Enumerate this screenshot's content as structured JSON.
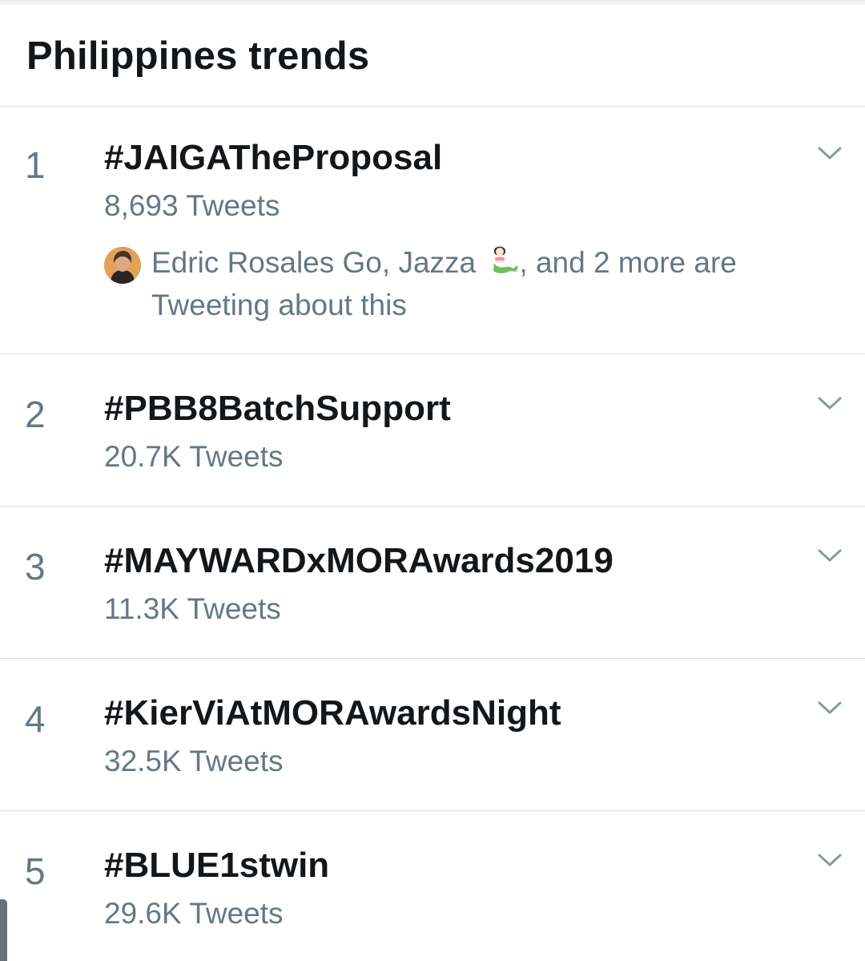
{
  "header": {
    "title": "Philippines trends"
  },
  "trends": [
    {
      "rank": "1",
      "name": "#JAIGATheProposal",
      "count": "8,693 Tweets",
      "context": {
        "names": "Edric Rosales Go, Jazza",
        "emoji_icon": "mermaid-emoji-icon",
        "suffix_line1": ", and 2 more are",
        "suffix_line2": "Tweeting about this"
      }
    },
    {
      "rank": "2",
      "name": "#PBB8BatchSupport",
      "count": "20.7K Tweets"
    },
    {
      "rank": "3",
      "name": "#MAYWARDxMORAwards2019",
      "count": "11.3K Tweets"
    },
    {
      "rank": "4",
      "name": "#KierViAtMORAwardsNight",
      "count": "32.5K Tweets"
    },
    {
      "rank": "5",
      "name": "#BLUE1stwin",
      "count": "29.6K Tweets"
    }
  ],
  "icons": {
    "chevron": "chevron-down-icon",
    "avatar": "avatar"
  },
  "colors": {
    "primary_text": "#14171a",
    "secondary_text": "#657786",
    "divider": "#d8dee3"
  }
}
